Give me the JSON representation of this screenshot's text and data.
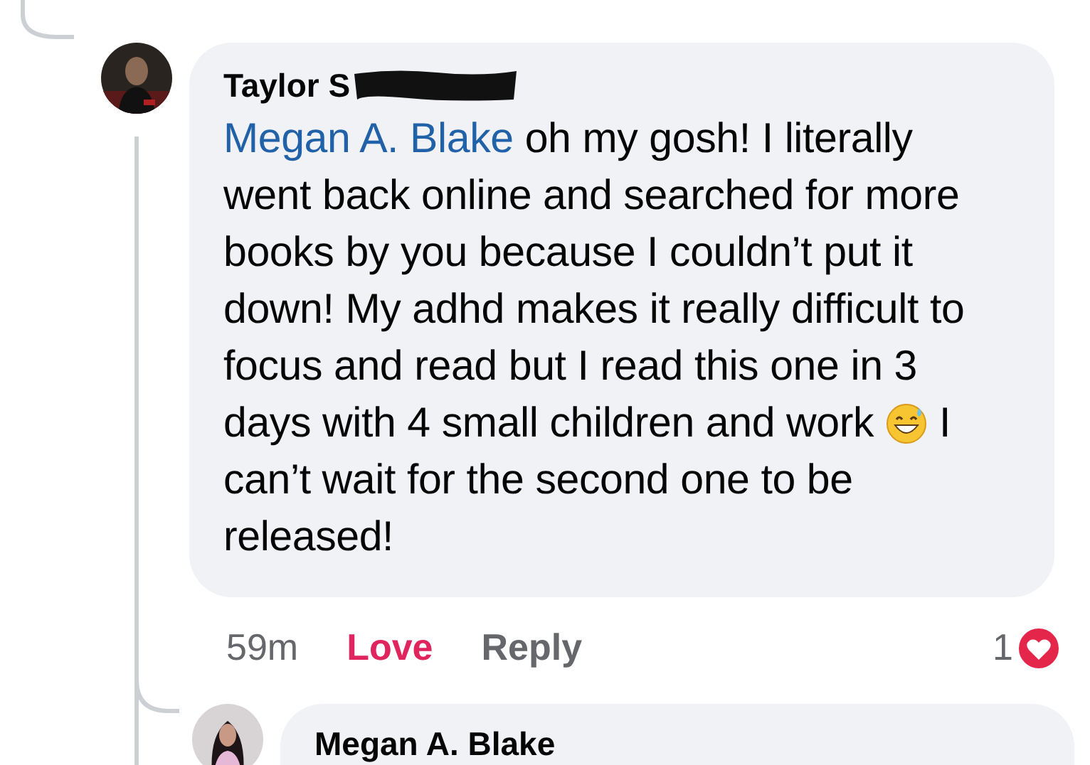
{
  "comment": {
    "author": "Taylor S",
    "author_redacted": true,
    "mention": "Megan A. Blake",
    "text_before_emoji": " oh my gosh! I literally went back online and searched for more books by you because I couldn’t put it down! My adhd makes it really difficult to focus and read but I read this one in 3 days with 4 small children and work ",
    "text_after_emoji": " I can’t wait for the second one to be released!",
    "time": "59m",
    "love": {
      "label": "Love",
      "selected": true
    },
    "reply": {
      "label": "Reply"
    },
    "reaction_count": "1"
  },
  "reply": {
    "author": "Megan A. Blake"
  }
}
